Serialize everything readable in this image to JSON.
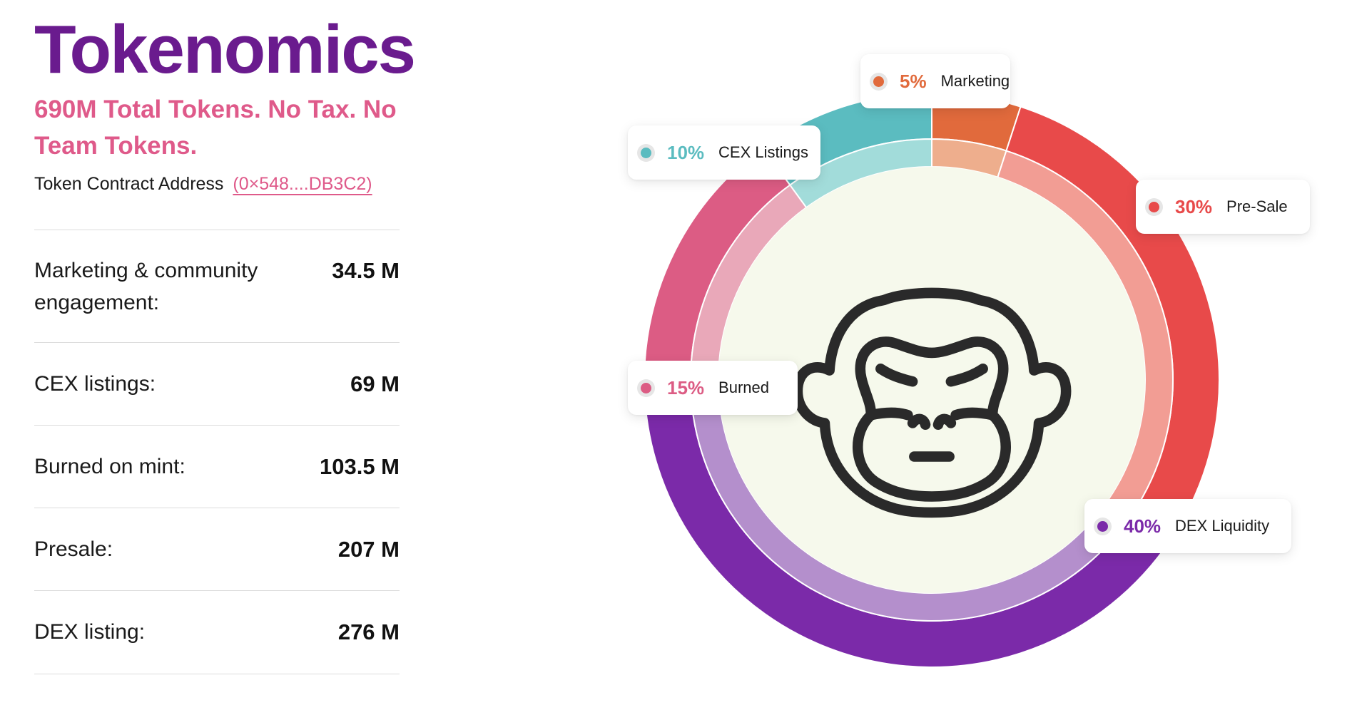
{
  "header": {
    "title": "Tokenomics",
    "subtitle": "690M Total Tokens. No Tax. No Team Tokens.",
    "contract_label": "Token Contract Address",
    "contract_address": "(0×548....DB3C2)"
  },
  "allocations_table": [
    {
      "label": "Marketing & community engagement:",
      "value": "34.5 M"
    },
    {
      "label": "CEX listings:",
      "value": "69 M"
    },
    {
      "label": "Burned on mint:",
      "value": "103.5 M"
    },
    {
      "label": "Presale:",
      "value": "207 M"
    },
    {
      "label": "DEX listing:",
      "value": "276 M"
    }
  ],
  "center_icon": "gorilla-face-icon",
  "chart_data": {
    "type": "pie",
    "variant": "donut",
    "legend_placement": "callouts around ring",
    "slices": [
      {
        "label": "Marketing",
        "percent_label": "5%",
        "value": 5,
        "color": "#e16a3c",
        "inner_color": "#eeae8d"
      },
      {
        "label": "Pre-Sale",
        "percent_label": "30%",
        "value": 30,
        "color": "#e84a4a",
        "inner_color": "#f29d94"
      },
      {
        "label": "DEX Liquidity",
        "percent_label": "40%",
        "value": 40,
        "color": "#7b2aa9",
        "inner_color": "#b48fcc"
      },
      {
        "label": "Burned",
        "percent_label": "15%",
        "value": 15,
        "color": "#dc5c84",
        "inner_color": "#e9a8b9"
      },
      {
        "label": "CEX Listings",
        "percent_label": "10%",
        "value": 10,
        "color": "#5bbcc0",
        "inner_color": "#a2dcda"
      }
    ],
    "center_fill": "#f6f9ec"
  }
}
